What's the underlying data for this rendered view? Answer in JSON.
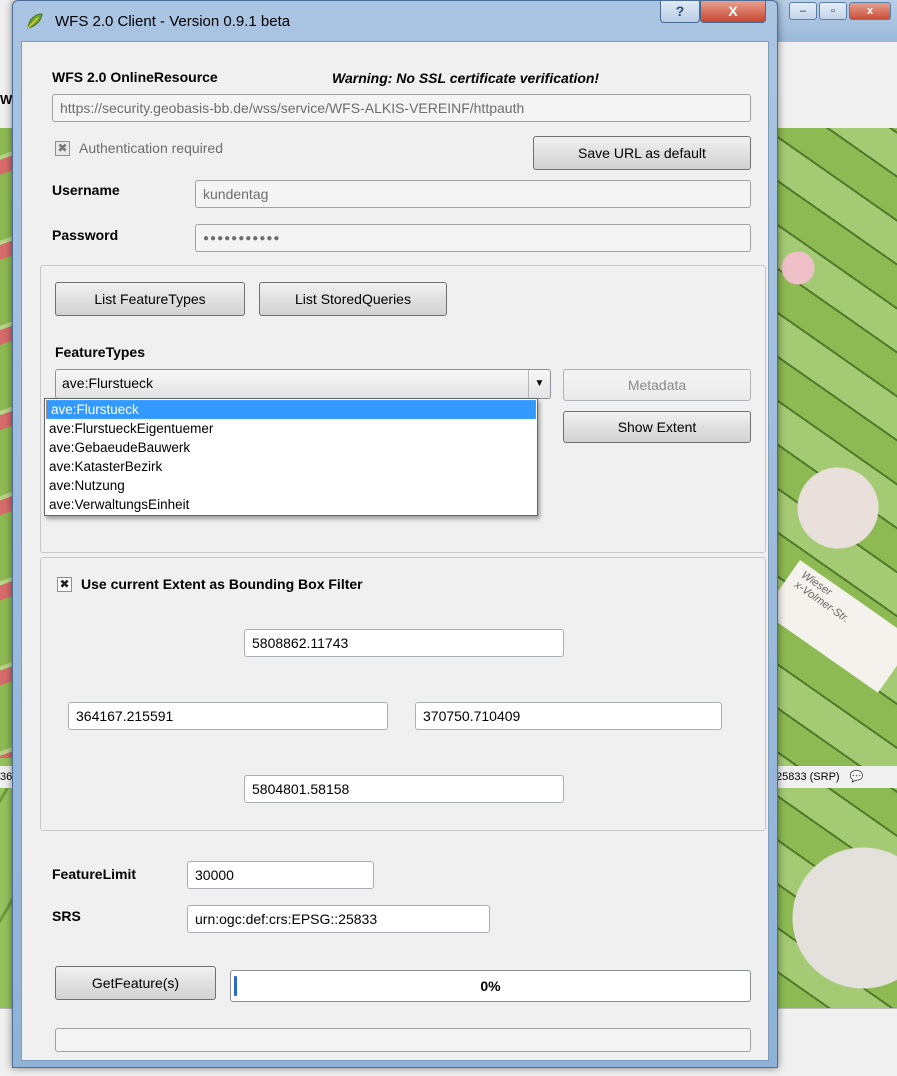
{
  "window": {
    "title": "WFS 2.0 Client - Version 0.9.1 beta",
    "help_label": "?",
    "close_label": "X"
  },
  "background": {
    "toolbar_fragment": "W",
    "status_left": "36",
    "status_right": "25833 (SRP)",
    "road_label": "Wieser\nx-Volmer-Str.",
    "minimize_label": "–",
    "restore_label": "▫",
    "close_label": "x"
  },
  "resource": {
    "label": "WFS 2.0 OnlineResource",
    "warning": "Warning: No SSL certificate verification!",
    "url": "https://security.geobasis-bb.de/wss/service/WFS-ALKIS-VEREINF/httpauth"
  },
  "auth": {
    "checkbox_label": "Authentication required",
    "checked_mark": "✖",
    "save_url_button": "Save URL as default",
    "username_label": "Username",
    "username_value": "kundentag",
    "password_label": "Password",
    "password_value": "●●●●●●●●●●●"
  },
  "feature_types": {
    "list_feature_types_button": "List FeatureTypes",
    "list_stored_queries_button": "List StoredQueries",
    "label": "FeatureTypes",
    "selected": "ave:Flurstueck",
    "options": [
      "ave:Flurstueck",
      "ave:FlurstueckEigentuemer",
      "ave:GebaeudeBauwerk",
      "ave:KatasterBezirk",
      "ave:Nutzung",
      "ave:VerwaltungsEinheit"
    ],
    "metadata_button": "Metadata",
    "show_extent_button": "Show Extent"
  },
  "bbox": {
    "checkbox_mark": "✖",
    "label": "Use current Extent as Bounding Box Filter",
    "north": "5808862.11743",
    "west": "364167.215591",
    "east": "370750.710409",
    "south": "5804801.58158"
  },
  "request": {
    "feature_limit_label": "FeatureLimit",
    "feature_limit_value": "30000",
    "srs_label": "SRS",
    "srs_value": "urn:ogc:def:crs:EPSG::25833",
    "get_feature_button": "GetFeature(s)",
    "progress_text": "0%",
    "progress_value": 0,
    "status_text": ""
  },
  "colors": {
    "dialog_frame": "#9ab9da",
    "selection": "#3399ff",
    "close_button": "#c74530"
  }
}
